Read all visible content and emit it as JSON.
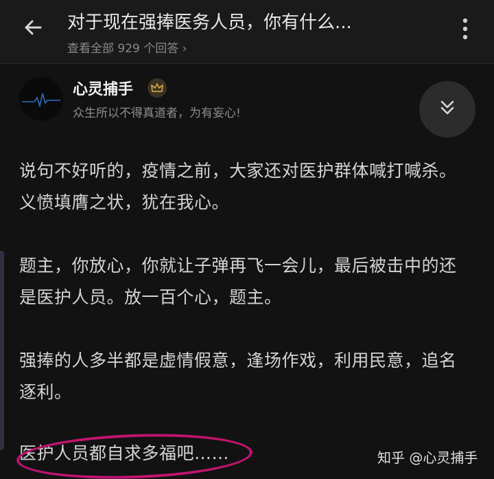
{
  "header": {
    "title": "对于现在强捧医务人员，你有什么...",
    "answers_link": "查看全部 929 个回答 ›"
  },
  "author": {
    "name": "心灵捕手",
    "bio": "众生所以不得真道者，为有妄心!"
  },
  "answer": {
    "paragraphs": [
      "说句不好听的，疫情之前，大家还对医护群体喊打喊杀。义愤填膺之状，犹在我心。",
      "题主，你放心，你就让子弹再飞一会儿，最后被击中的还是医护人员。放一百个心，题主。",
      "强捧的人多半都是虚情假意，逢场作戏，利用民意，追名逐利。",
      "医护人员都自求多福吧……"
    ]
  },
  "watermark": "知乎 @心灵捕手",
  "icons": {
    "back": "arrow-left-icon",
    "more": "more-vertical-icon",
    "badge": "crown-badge-icon",
    "fold": "chevrons-down-icon"
  },
  "colors": {
    "background": "#121212",
    "badge": "#c9a14a",
    "highlight_ellipse": "#c0146e"
  }
}
